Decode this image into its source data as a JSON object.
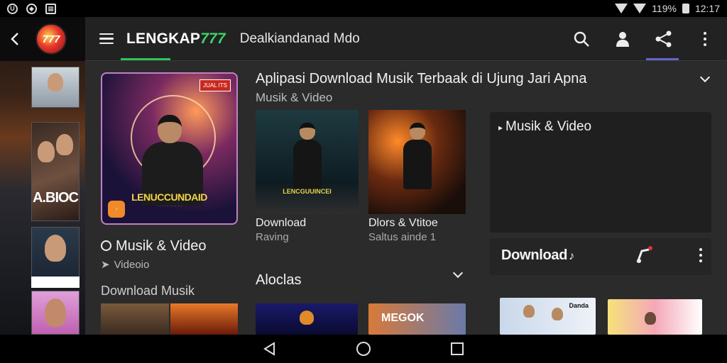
{
  "status_bar": {
    "left_icons": [
      "u-badge-icon",
      "shield-icon",
      "calendar-icon"
    ],
    "battery_text": "119%",
    "time": "12:17"
  },
  "rail": {
    "logo_text": "777",
    "thumb_caption": "A.BIOC"
  },
  "topbar": {
    "brand_text": "LENGKAP",
    "brand_number": "777",
    "subtitle": "Dealkiandanad Mdo"
  },
  "featured": {
    "badge": "JUAL ITS",
    "title": "LENUCCUNDAID",
    "label": "Musik & Video",
    "sublabel": "Videoio"
  },
  "left_section": {
    "label": "Download Musik"
  },
  "middle": {
    "title": "Aplipasi Download Musik Terbaak di Ujung Jari Apna",
    "subtitle": "Musik & Video",
    "cards": [
      {
        "caption": "Download",
        "sub": "Raving",
        "art_title": "LENCGUUINCEI"
      },
      {
        "caption": "Dlors & Vtitoe",
        "sub": "Saltus ainde 1"
      }
    ],
    "section2_label": "Aloclas",
    "bottom_cards": [
      {
        "art_text": ""
      },
      {
        "art_text": "MEGOK"
      }
    ]
  },
  "right_panel": {
    "label": "Musik & Video",
    "download_label": "Download",
    "thumb1_tag": "Danda",
    "thumb2_tag": ""
  },
  "colors": {
    "brand_green": "#3ed36a",
    "accent_purple": "#6466c8",
    "featured_border": "#c080c8"
  }
}
